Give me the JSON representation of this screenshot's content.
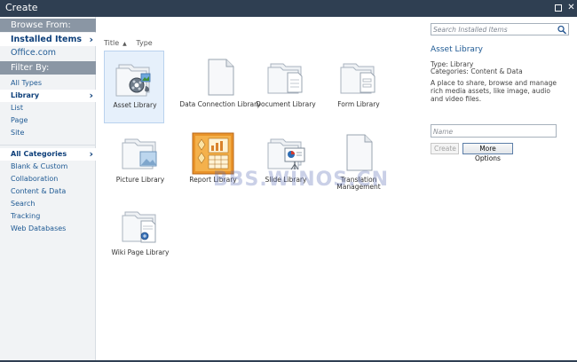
{
  "window": {
    "title": "Create"
  },
  "browse_from": {
    "header": "Browse From:",
    "items": [
      {
        "label": "Installed Items",
        "selected": true
      },
      {
        "label": "Office.com",
        "selected": false
      }
    ]
  },
  "filter_by": {
    "header": "Filter By:",
    "types": [
      {
        "label": "All Types",
        "selected": false
      },
      {
        "label": "Library",
        "selected": true
      },
      {
        "label": "List",
        "selected": false
      },
      {
        "label": "Page",
        "selected": false
      },
      {
        "label": "Site",
        "selected": false
      }
    ],
    "categories": [
      {
        "label": "All Categories",
        "selected": true
      },
      {
        "label": "Blank & Custom",
        "selected": false
      },
      {
        "label": "Collaboration",
        "selected": false
      },
      {
        "label": "Content & Data",
        "selected": false
      },
      {
        "label": "Search",
        "selected": false
      },
      {
        "label": "Tracking",
        "selected": false
      },
      {
        "label": "Web Databases",
        "selected": false
      }
    ]
  },
  "sort": {
    "title": "Title",
    "type": "Type"
  },
  "tiles": [
    {
      "label": "Asset Library",
      "selected": true
    },
    {
      "label": "Data Connection Library"
    },
    {
      "label": "Document Library"
    },
    {
      "label": "Form Library"
    },
    {
      "label": "Picture Library"
    },
    {
      "label": "Report Library"
    },
    {
      "label": "Slide Library"
    },
    {
      "label": "Translation Management"
    },
    {
      "label": "Wiki Page Library"
    }
  ],
  "details": {
    "search_placeholder": "Search Installed Items",
    "title": "Asset Library",
    "type_line": "Type: Library",
    "categories_line": "Categories: Content & Data",
    "description": "A place to share, browse and manage rich media assets, like image, audio and video files.",
    "name_placeholder": "Name",
    "create_label": "Create",
    "more_options_label": "More Options"
  },
  "watermark": "BBS.WINOS.CN",
  "colors": {
    "titlebar": "#2f3f52",
    "nav_header": "#8a96a4",
    "link": "#1f5a94",
    "selected_tile": "#e6f0fb"
  }
}
